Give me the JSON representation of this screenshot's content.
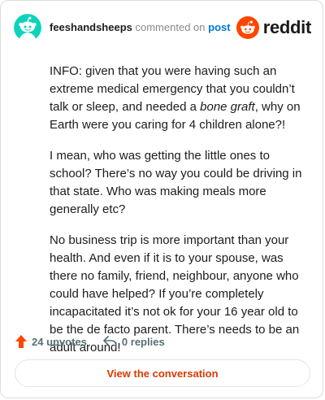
{
  "header": {
    "username": "feeshandsheeps",
    "action_text": "commented on",
    "post_link_label": "post",
    "brand_name": "reddit"
  },
  "comment": {
    "paragraph_1": {
      "before_emphasis": "INFO: given that you were having such an extreme medical emergency that you couldn’t talk or sleep, and needed a ",
      "emphasis": "bone graft",
      "after_emphasis": ", why on Earth were you caring for 4 children alone?!"
    },
    "paragraph_2": "I mean, who was getting the little ones to school? There’s no way you could be driving in that state. Who was making meals more generally etc?",
    "paragraph_3": "No business trip is more important than your health. And even if it is to your spouse, was there no family, friend, neighbour, anyone who could have helped? If you’re completely incapacitated it’s not ok for your 16 year old to be the de facto parent. There’s needs to be an adult around!"
  },
  "footer": {
    "upvotes_label": "24 upvotes",
    "replies_label": "0 replies",
    "view_conversation_label": "View the conversation"
  },
  "colors": {
    "brand_orange": "#ff4500",
    "avatar_teal": "#0dd3bb",
    "link_blue": "#0079d3",
    "upvote_orange": "#ff4500",
    "button_text": "#d93a00"
  },
  "icons": {
    "avatar": "snoo-avatar-icon",
    "brand": "reddit-logo-icon",
    "upvote": "upvote-arrow-icon",
    "reply": "reply-arrow-icon"
  }
}
